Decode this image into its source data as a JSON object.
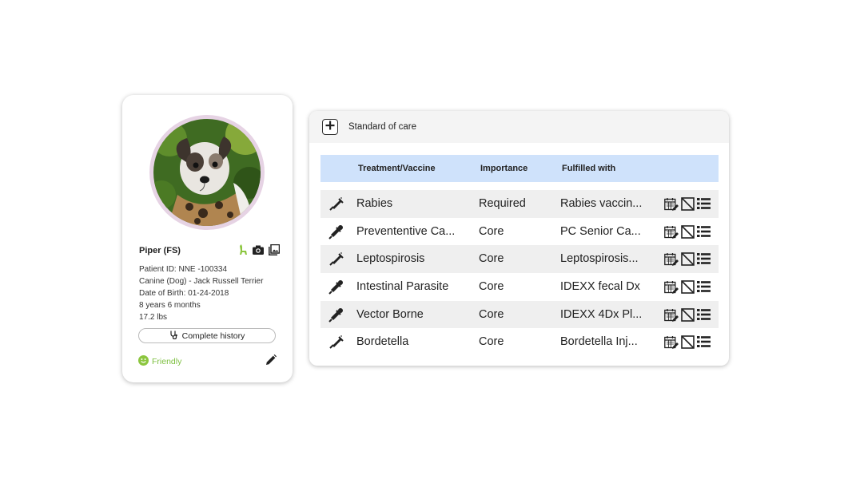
{
  "patient": {
    "name": "Piper (FS)",
    "patient_id": "Patient ID: NNE -100334",
    "species_breed": "Canine (Dog) - Jack Russell Terrier",
    "dob": "Date of Birth: 01-24-2018",
    "age": "8 years 6 months",
    "weight": "17.2 lbs",
    "history_button": "Complete history",
    "temperament": "Friendly",
    "temperament_color": "#7cbf3f",
    "avatar_ring_color": "#e6d3e4"
  },
  "care": {
    "title": "Standard of care",
    "columns": {
      "treatment": "Treatment/Vaccine",
      "importance": "Importance",
      "fulfilled": "Fulfilled with"
    },
    "header_color": "#cfe2fb",
    "rows": [
      {
        "icon": "syringe-icon",
        "name": "Rabies",
        "importance": "Required",
        "fulfilled": "Rabies vaccin..."
      },
      {
        "icon": "pill-dropper-icon",
        "name": "Prevententive Ca...",
        "importance": "Core",
        "fulfilled": "PC Senior Ca..."
      },
      {
        "icon": "syringe-icon",
        "name": "Leptospirosis",
        "importance": "Core",
        "fulfilled": "Leptospirosis..."
      },
      {
        "icon": "pill-dropper-icon",
        "name": "Intestinal Parasite",
        "importance": "Core",
        "fulfilled": "IDEXX fecal Dx"
      },
      {
        "icon": "pill-dropper-icon",
        "name": "Vector Borne",
        "importance": "Core",
        "fulfilled": "IDEXX 4Dx Pl..."
      },
      {
        "icon": "syringe-icon",
        "name": "Bordetella",
        "importance": "Core",
        "fulfilled": "Bordetella Inj..."
      }
    ],
    "row_actions": [
      "schedule-edit-icon",
      "decline-icon",
      "list-icon"
    ]
  }
}
